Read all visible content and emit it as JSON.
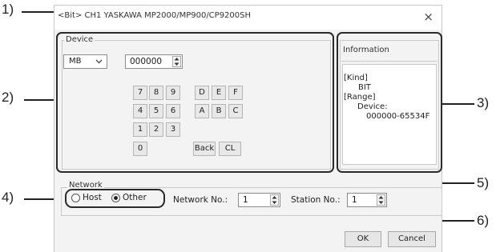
{
  "callouts": [
    "1)",
    "2)",
    "3)",
    "4)",
    "5)",
    "6)"
  ],
  "dialog": {
    "title": "<Bit> CH1 YASKAWA MP2000/MP900/CP9200SH",
    "close_glyph": "×"
  },
  "device": {
    "group_label": "Device",
    "device_type": "MB",
    "dropdown_icon": "chevron-down",
    "address": "000000",
    "keys": [
      "7",
      "8",
      "9",
      "D",
      "E",
      "F",
      "4",
      "5",
      "6",
      "A",
      "B",
      "C",
      "1",
      "2",
      "3",
      "0"
    ],
    "back_label": "Back",
    "clear_label": "CL"
  },
  "information": {
    "title": "Information",
    "lines": [
      "[Kind]",
      "BIT",
      "[Range]",
      "Device:",
      "000000-65534F"
    ]
  },
  "network": {
    "group_label": "Network",
    "host_label": "Host",
    "other_label": "Other",
    "selected": "Other",
    "network_no_label": "Network No.:",
    "network_no_value": "1",
    "station_no_label": "Station No.:",
    "station_no_value": "1"
  },
  "buttons": {
    "ok": "OK",
    "cancel": "Cancel"
  }
}
